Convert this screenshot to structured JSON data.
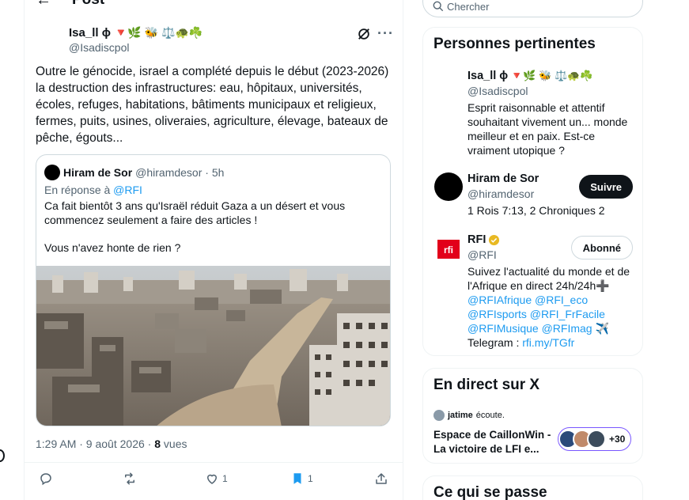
{
  "post_header": {
    "title": "Post"
  },
  "tweet": {
    "author_name": "Isa_ll ɸ",
    "author_emojis": "🔻🌿 🐝 ⚖️🐢☘️",
    "author_handle": "@Isadiscpol",
    "text": "Outre le génocide, israel a complété depuis le début (2023-2026) la destruction des infrastructures: eau, hôpitaux, universités, écoles, refuges, habitations, bâtiments municipaux et religieux, fermes, puits, usines, oliveraies, agriculture, élevage, bateaux de pêche, égouts...",
    "timestamp": "1:29 AM · 9 août 2026 · ",
    "views_count": "8",
    "views_label": " vues",
    "likes": "1",
    "bookmarks": "1"
  },
  "quote": {
    "name": "Hiram de Sor",
    "meta": "@hiramdesor · 5h",
    "reply_prefix": "En réponse à ",
    "reply_handle": "@RFI",
    "text": "Ca fait bientôt 3 ans qu'Israël réduit Gaza a un désert et vous commencez seulement a faire des articles !",
    "text2": "Vous n'avez honte de rien ?"
  },
  "search": {
    "placeholder": "Chercher"
  },
  "relevant": {
    "title": "Personnes pertinentes",
    "people": [
      {
        "name": "Isa_ll ɸ",
        "emojis": "🔻🌿 🐝 ⚖️🐢☘️",
        "handle": "@Isadiscpol",
        "bio": "Esprit raisonnable et attentif souhaitant vivement un... monde meilleur et en paix. Est-ce vraiment utopique ?"
      },
      {
        "name": "Hiram de Sor",
        "handle": "@hiramdesor",
        "bio": "1 Rois 7:13, 2 Chroniques 2",
        "button": "Suivre"
      },
      {
        "name": "RFI",
        "handle": "@RFI",
        "bio_text": "Suivez l'actualité du monde et de l'Afrique en direct 24h/24h➕",
        "bio_links": "@RFIAfrique @RFI_eco @RFIsports @RFI_FrFacile @RFIMusique @RFImag ✈️",
        "bio_tg_label": "Telegram : ",
        "bio_tg_link": "rfi.my/TGfr",
        "button": "Abonné"
      }
    ]
  },
  "live": {
    "title": "En direct sur X",
    "user": "jatime",
    "status": "écoute.",
    "space_title": "Espace de CaillonWin - La victoire de LFI e...",
    "listeners": "+30"
  },
  "trending": {
    "title": "Ce qui se passe"
  },
  "colors": {
    "accent": "#1d9bf0",
    "text": "#0f1419",
    "muted": "#536471",
    "border": "#cfd9de",
    "spaces": "#7856ff",
    "rfi_red": "#e2001a"
  }
}
